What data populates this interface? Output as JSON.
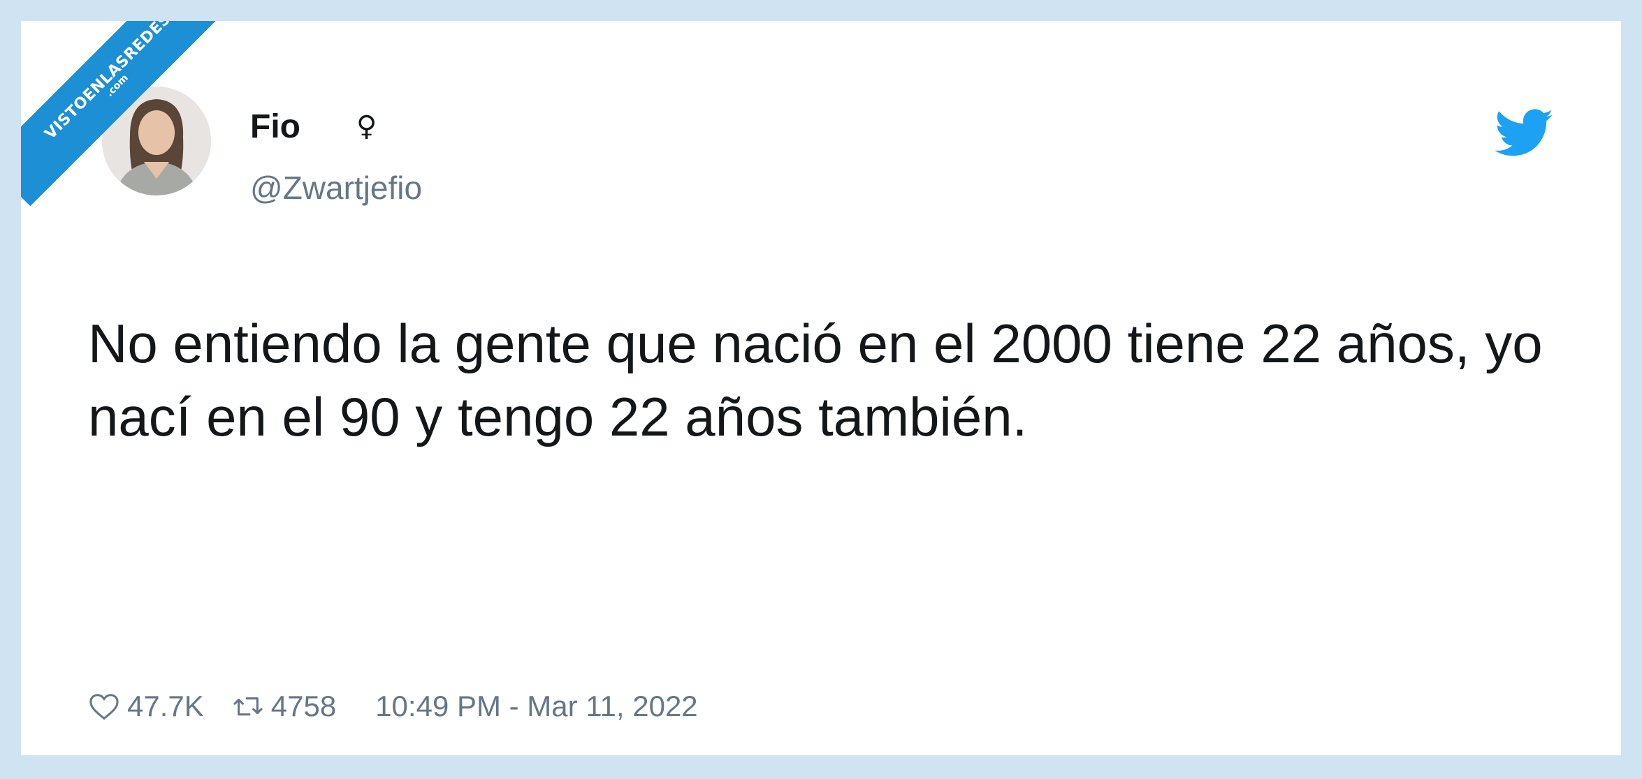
{
  "watermark": {
    "main": "VISTOENLASREDES",
    "sub": ".com"
  },
  "tweet": {
    "author_name": "Fio",
    "author_badge": "♀",
    "handle": "@Zwartjefio",
    "text": "No entiendo la gente que nació en el 2000 tiene 22 años, yo nací en el 90 y tengo 22 años también.",
    "likes": "47.7K",
    "retweets": "4758",
    "timestamp": "10:49 PM - Mar 11, 2022"
  },
  "colors": {
    "twitter_blue": "#1da1f2",
    "text_primary": "#14171a",
    "text_secondary": "#657786",
    "ribbon": "#1d8fd4",
    "frame": "#cfe3f2"
  },
  "icons": {
    "like": "heart-outline-icon",
    "retweet": "retweet-icon",
    "brand": "twitter-bird-icon"
  }
}
